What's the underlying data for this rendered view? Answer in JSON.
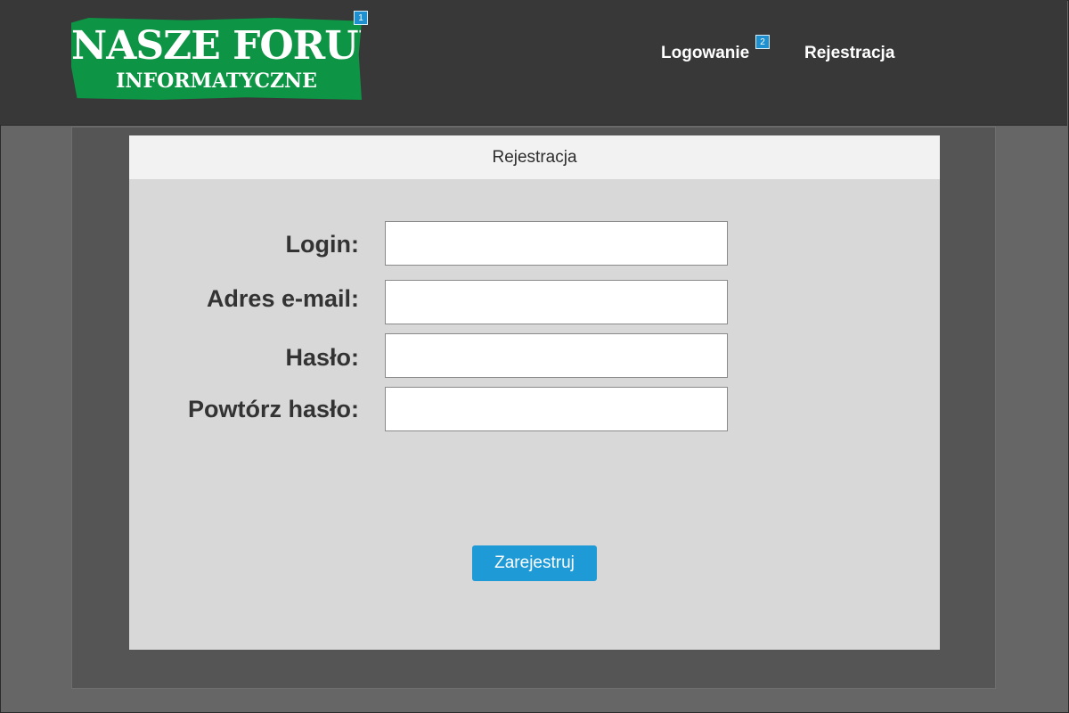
{
  "header": {
    "logo": {
      "title": "NASZE FORUM",
      "subtitle": "INFORMATYCZNE",
      "badge": "1"
    },
    "nav": {
      "login_label": "Logowanie",
      "login_badge": "2",
      "register_label": "Rejestracja"
    }
  },
  "form": {
    "title": "Rejestracja",
    "fields": [
      {
        "label": "Login:",
        "value": "",
        "placeholder": ""
      },
      {
        "label": "Adres e-mail:",
        "value": "",
        "placeholder": ""
      },
      {
        "label": "Hasło:",
        "value": "",
        "placeholder": ""
      },
      {
        "label": "Powtórz hasło:",
        "value": "",
        "placeholder": ""
      }
    ],
    "submit_label": "Zarejestruj"
  },
  "colors": {
    "header_bg": "#383838",
    "logo_green": "#0d9444",
    "accent_blue": "#1e9ad6",
    "card_bg": "#d8d8d8",
    "card_header_bg": "#f2f2f2"
  }
}
